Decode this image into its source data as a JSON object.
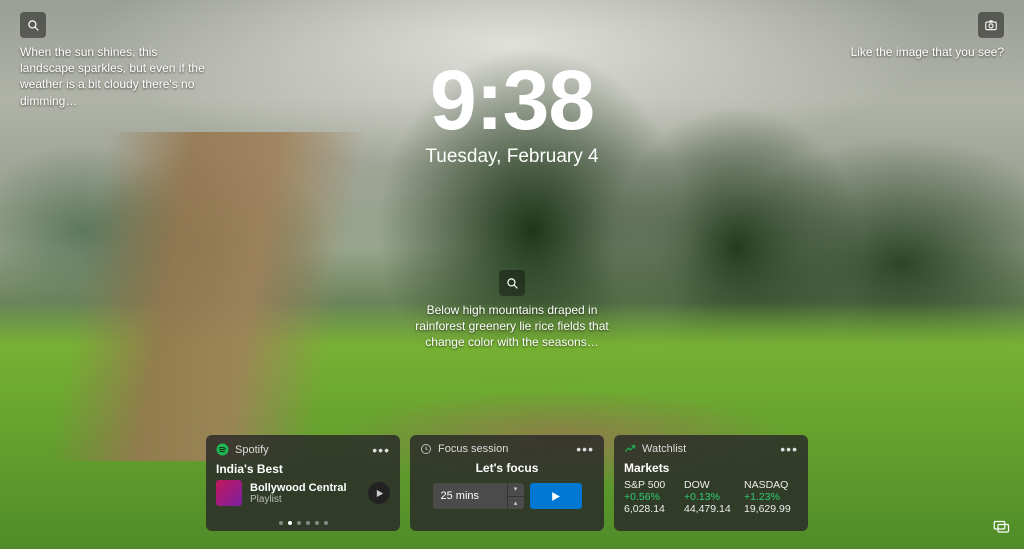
{
  "clock": {
    "time": "9:38",
    "date": "Tuesday, February 4"
  },
  "spotlight": {
    "top_left": "When the sun shines, this landscape sparkles, but even if the weather is a bit cloudy there's no dimming…",
    "top_right": "Like the image that you see?",
    "middle": "Below high mountains draped in rainforest greenery lie rice fields that change color with the seasons…"
  },
  "widgets": {
    "spotify": {
      "app": "Spotify",
      "section": "India's Best",
      "track": "Bollywood Central",
      "type": "Playlist"
    },
    "focus": {
      "app": "Focus session",
      "heading": "Let's focus",
      "duration": "25 mins"
    },
    "watchlist": {
      "app": "Watchlist",
      "section": "Markets",
      "items": [
        {
          "name": "S&P 500",
          "change": "+0.56%",
          "value": "6,028.14"
        },
        {
          "name": "DOW",
          "change": "+0.13%",
          "value": "44,479.14"
        },
        {
          "name": "NASDAQ",
          "change": "+1.23%",
          "value": "19,629.99"
        }
      ]
    }
  }
}
